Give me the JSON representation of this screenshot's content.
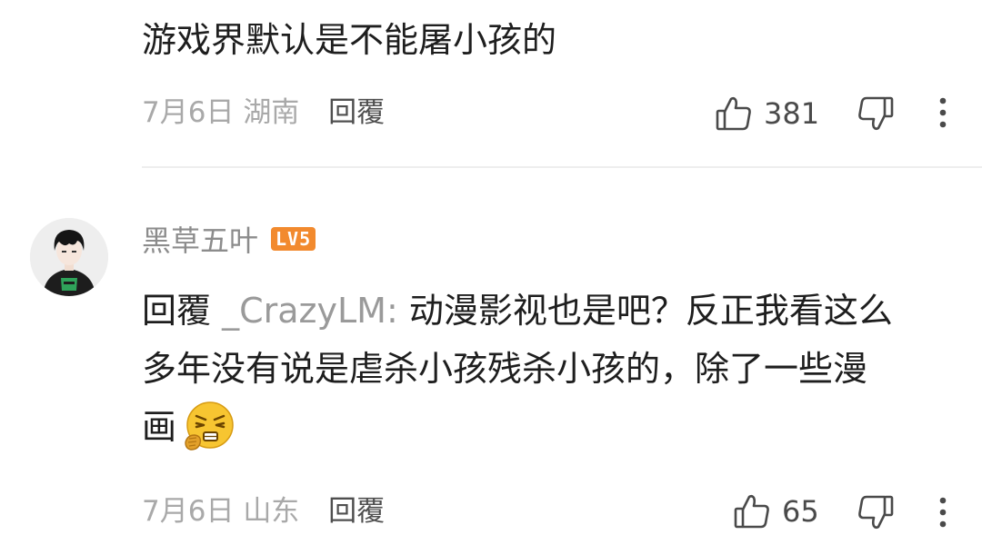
{
  "comments": [
    {
      "text": "游戏界默认是不能屠小孩的",
      "date": "7月6日",
      "location": "湖南",
      "reply_label": "回覆",
      "like_count": "381"
    },
    {
      "username": "黑草五叶",
      "level": "LV5",
      "reply_prefix": "回覆",
      "reply_to": "_CrazyLM:",
      "text_line1": "动漫影视也是吧？反正我看这么",
      "text_line2": "多年没有说是虐杀小孩残杀小孩的，除了一些漫",
      "text_line3": "画",
      "emoji": "frustrated-face",
      "date": "7月6日",
      "location": "山东",
      "reply_label": "回覆",
      "like_count": "65"
    }
  ],
  "colors": {
    "level_badge": "#f28a2e",
    "meta_text": "#a9a9a9",
    "body_text": "#1e1e1e"
  },
  "icons": {
    "like": "thumbs-up-outline",
    "dislike": "thumbs-down-outline",
    "more": "vertical-ellipsis"
  }
}
